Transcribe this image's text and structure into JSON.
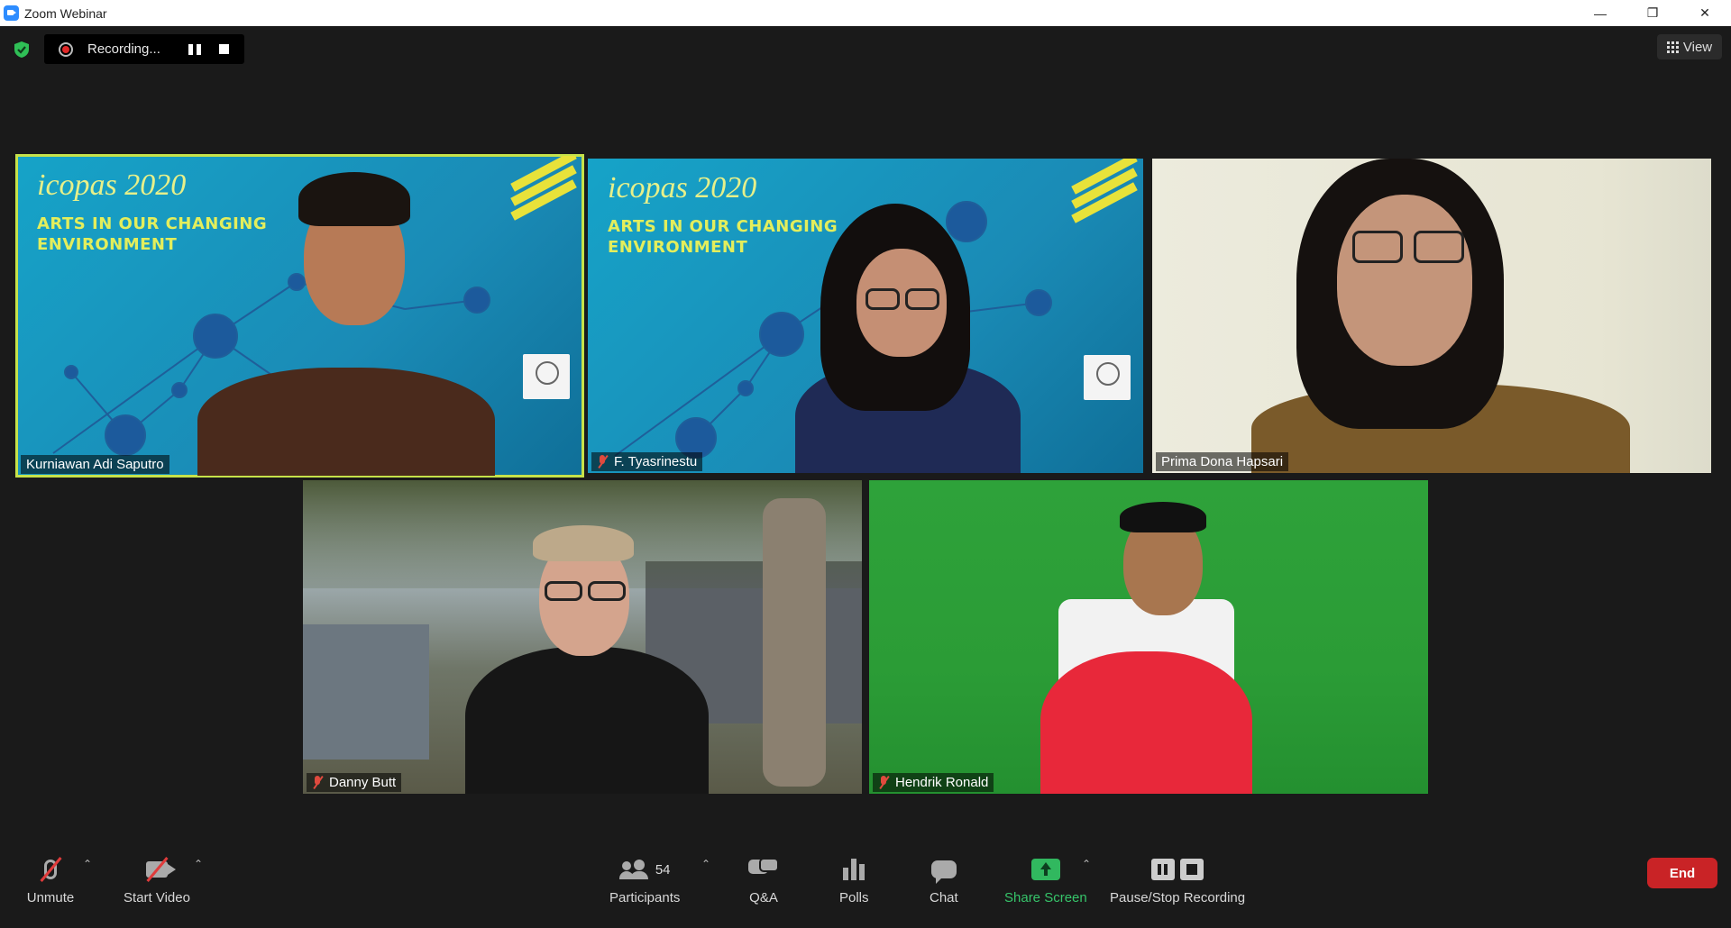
{
  "window": {
    "title": "Zoom Webinar",
    "minimize": "—",
    "restore": "❐",
    "close": "✕"
  },
  "recording": {
    "label": "Recording..."
  },
  "view_button": {
    "label": "View"
  },
  "banner": {
    "logo": "icopas 2020",
    "line1": "ARTS IN OUR CHANGING",
    "line2": "ENVIRONMENT"
  },
  "participants": [
    {
      "name": "Kurniawan Adi Saputro",
      "muted": false,
      "active_speaker": true
    },
    {
      "name": "F. Tyasrinestu",
      "muted": true,
      "active_speaker": false
    },
    {
      "name": "Prima Dona Hapsari",
      "muted": false,
      "active_speaker": false
    },
    {
      "name": "Danny Butt",
      "muted": true,
      "active_speaker": false
    },
    {
      "name": "Hendrik Ronald",
      "muted": true,
      "active_speaker": false
    }
  ],
  "toolbar": {
    "unmute": "Unmute",
    "start_video": "Start Video",
    "participants": "Participants",
    "participants_count": "54",
    "qa": "Q&A",
    "polls": "Polls",
    "chat": "Chat",
    "share_screen": "Share Screen",
    "pause_stop": "Pause/Stop Recording",
    "end": "End"
  },
  "colors": {
    "speaker_outline": "#c6e24a",
    "share_green": "#31b85f",
    "end_red": "#c92326",
    "mute_red": "#e04a3e"
  }
}
